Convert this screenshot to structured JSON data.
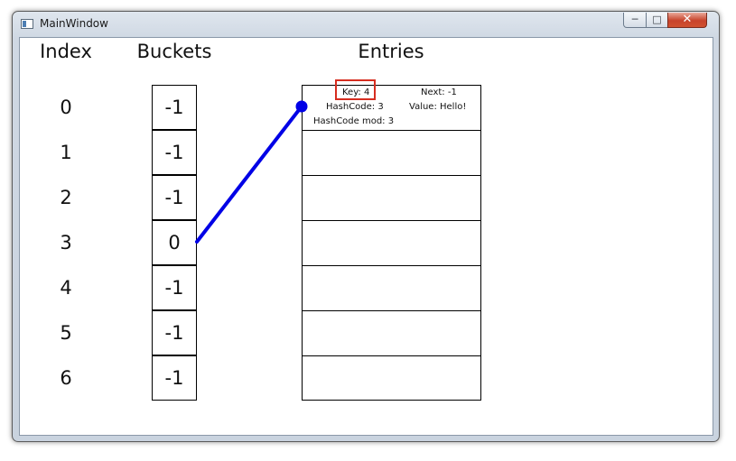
{
  "window": {
    "title": "MainWindow"
  },
  "controls": {
    "minimize": "─",
    "maximize": "□",
    "close": "✕"
  },
  "headers": {
    "index": "Index",
    "buckets": "Buckets",
    "entries": "Entries"
  },
  "indices": [
    "0",
    "1",
    "2",
    "3",
    "4",
    "5",
    "6"
  ],
  "buckets": [
    "-1",
    "-1",
    "-1",
    "0",
    "-1",
    "-1",
    "-1"
  ],
  "entries": [
    {
      "key": "Key: 4",
      "next": "Next: -1",
      "hashcode": "HashCode: 3",
      "value": "Value: Hello!",
      "hashcode_mod": "HashCode mod: 3"
    }
  ],
  "link": {
    "from_bucket_index": 3,
    "to_entry_index": 0,
    "color": "#0000e6"
  },
  "highlight": {
    "field": "key",
    "color": "#d62d20"
  }
}
